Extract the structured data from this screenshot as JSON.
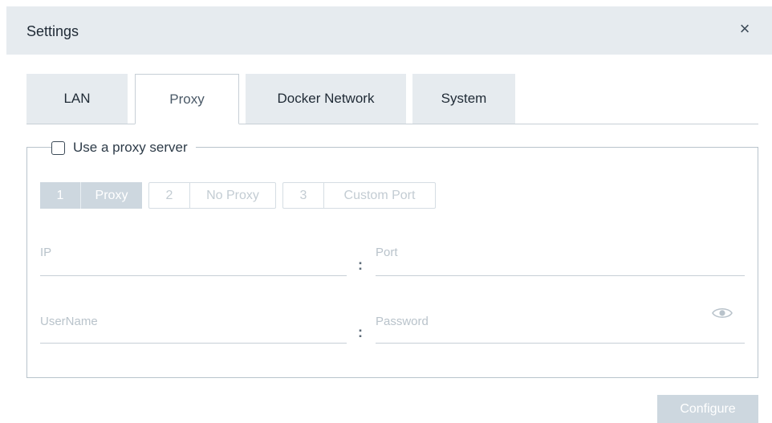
{
  "dialog": {
    "title": "Settings",
    "close_glyph": "×"
  },
  "tabs": [
    {
      "label": "LAN",
      "active": false
    },
    {
      "label": "Proxy",
      "active": true
    },
    {
      "label": "Docker Network",
      "active": false
    },
    {
      "label": "System",
      "active": false
    }
  ],
  "proxy_section": {
    "checkbox_label": "Use a proxy server",
    "checked": false,
    "steps": [
      {
        "number": "1",
        "label": "Proxy",
        "active": true
      },
      {
        "number": "2",
        "label": "No Proxy",
        "active": false
      },
      {
        "number": "3",
        "label": "Custom Port",
        "active": false
      }
    ],
    "fields": {
      "ip_placeholder": "IP",
      "port_placeholder": "Port",
      "username_placeholder": "UserName",
      "password_placeholder": "Password",
      "separator": ":"
    },
    "password_toggle_icon": "eye-icon"
  },
  "actions": {
    "configure_label": "Configure"
  },
  "colors": {
    "header_bg": "#e6ebef",
    "disabled_button": "#cdd7df",
    "border": "#b9c4cc"
  }
}
